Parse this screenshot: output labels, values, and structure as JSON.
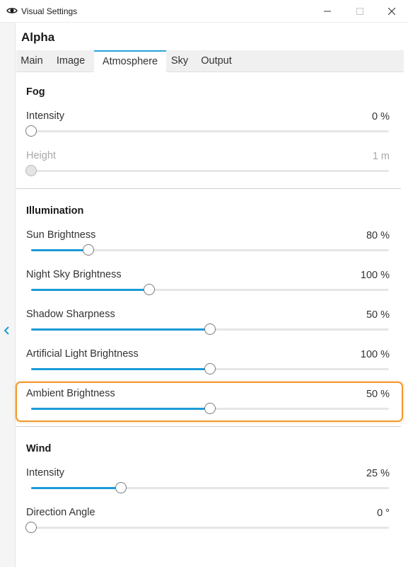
{
  "window": {
    "title": "Visual Settings",
    "icon": "eye-icon",
    "controls": [
      "minimize-icon",
      "maximize-icon",
      "close-icon"
    ]
  },
  "panel": {
    "title": "Alpha",
    "collapse_icon": "chevron-left-icon"
  },
  "tabs": [
    {
      "label": "Main",
      "active": false
    },
    {
      "label": "Image",
      "active": false
    },
    {
      "label": "Atmosphere",
      "active": true
    },
    {
      "label": "Sky",
      "active": false
    },
    {
      "label": "Output",
      "active": false
    }
  ],
  "sections": {
    "fog": {
      "title": "Fog",
      "rows": [
        {
          "label": "Intensity",
          "value": "0 %",
          "level": 0,
          "enabled": true
        },
        {
          "label": "Height",
          "value": "1 m",
          "level": 0,
          "enabled": false
        }
      ]
    },
    "illumination": {
      "title": "Illumination",
      "rows": [
        {
          "label": "Sun Brightness",
          "value": "80 %",
          "level": 0.16,
          "enabled": true
        },
        {
          "label": "Night Sky Brightness",
          "value": "100 %",
          "level": 0.33,
          "enabled": true
        },
        {
          "label": "Shadow Sharpness",
          "value": "50 %",
          "level": 0.5,
          "enabled": true
        },
        {
          "label": "Artificial Light Brightness",
          "value": "100 %",
          "level": 0.5,
          "enabled": true
        },
        {
          "label": "Ambient Brightness",
          "value": "50 %",
          "level": 0.5,
          "enabled": true,
          "highlighted": true
        }
      ]
    },
    "wind": {
      "title": "Wind",
      "rows": [
        {
          "label": "Intensity",
          "value": "25 %",
          "level": 0.25,
          "enabled": true
        },
        {
          "label": "Direction Angle",
          "value": "0 °",
          "level": 0,
          "enabled": true
        }
      ]
    }
  },
  "colors": {
    "accent": "#1b9bd8",
    "highlight": "#f29a2e",
    "track": "#e6e6e6"
  }
}
